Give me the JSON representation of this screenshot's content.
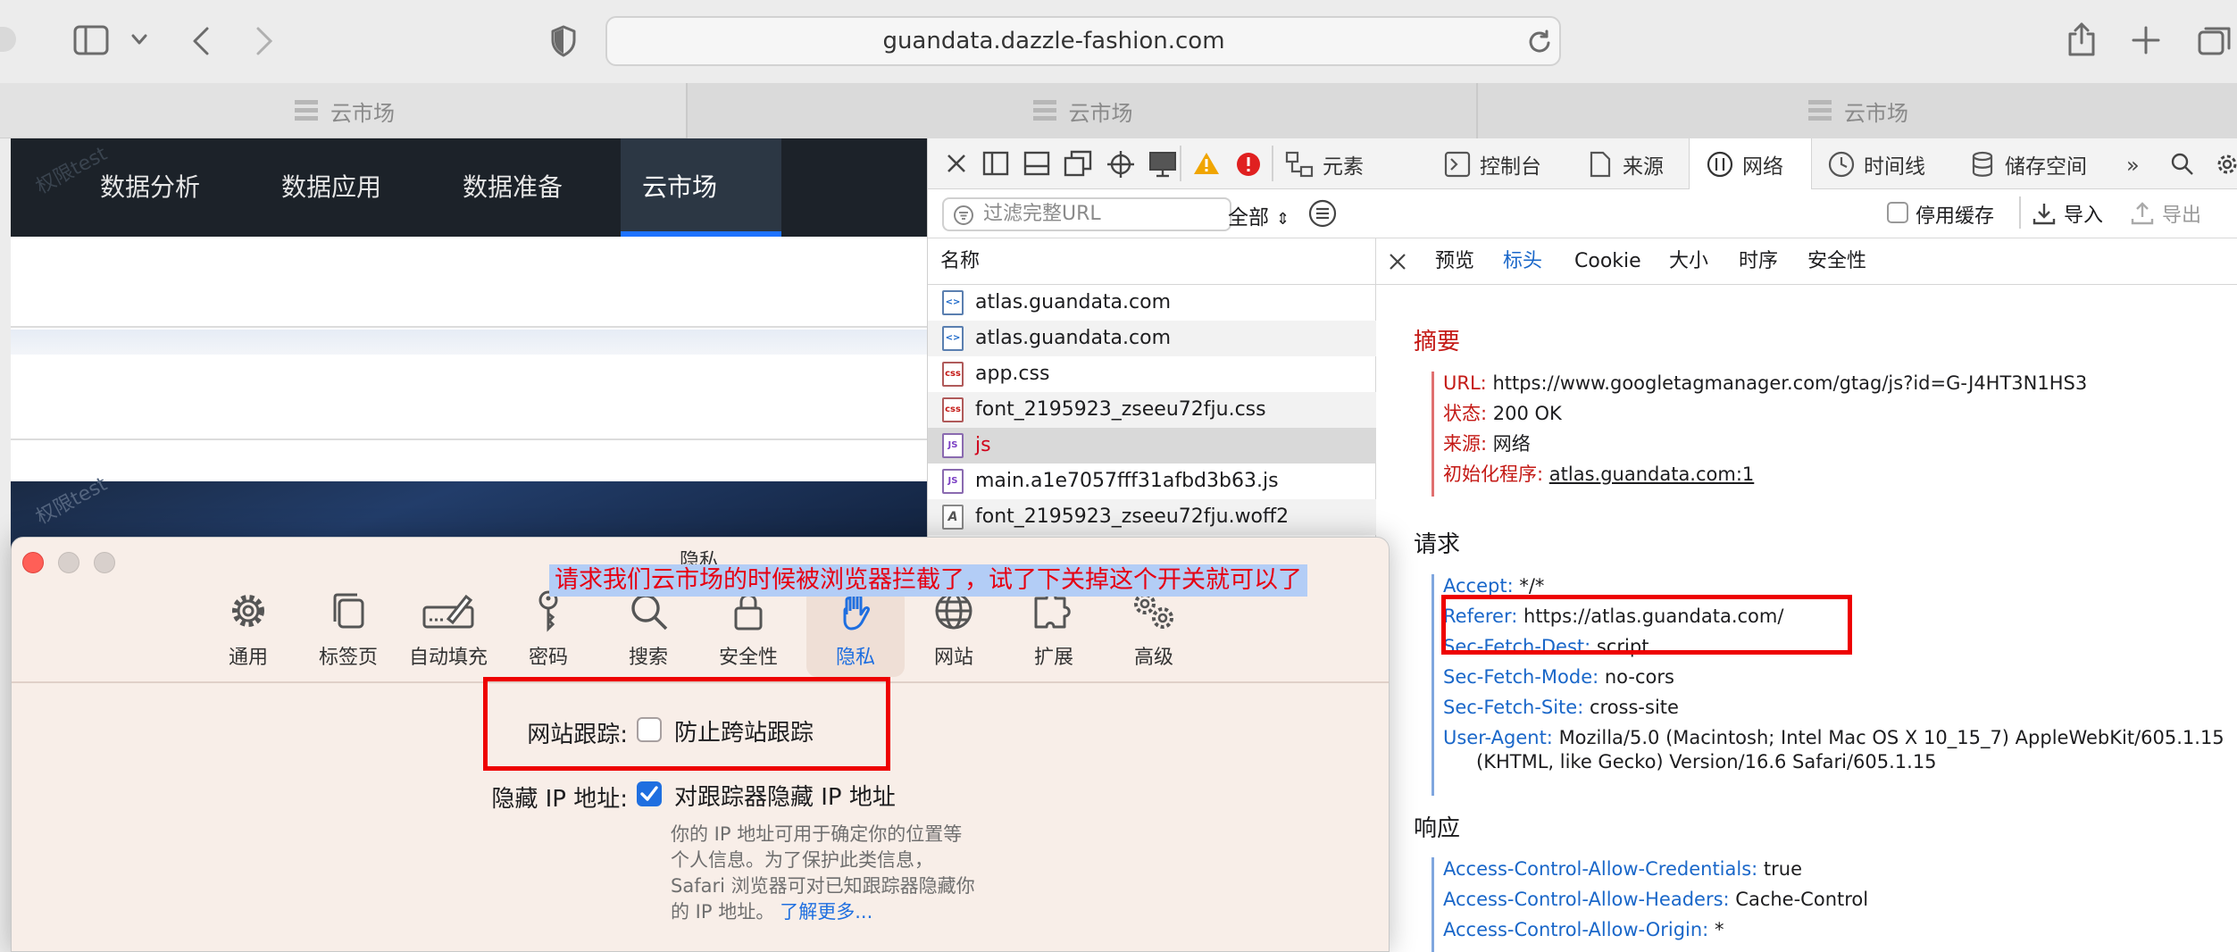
{
  "browser": {
    "url": "guandata.dazzle-fashion.com",
    "tabs": [
      {
        "label": "云市场"
      },
      {
        "label": "云市场"
      },
      {
        "label": "云市场"
      }
    ]
  },
  "webpage": {
    "nav": [
      "数据分析",
      "数据应用",
      "数据准备",
      "云市场"
    ],
    "active_nav": "云市场",
    "watermark": "权限test"
  },
  "devtools": {
    "tabs": [
      "元素",
      "控制台",
      "来源",
      "网络",
      "时间线",
      "储存空间"
    ],
    "active_tab": "网络",
    "filter_placeholder": "过滤完整URL",
    "type_filter": "全部",
    "disable_cache": "停用缓存",
    "import": "导入",
    "export": "导出",
    "list_header": "名称",
    "requests": [
      {
        "name": "atlas.guandata.com",
        "type": "html"
      },
      {
        "name": "atlas.guandata.com",
        "type": "html"
      },
      {
        "name": "app.css",
        "type": "css"
      },
      {
        "name": "font_2195923_zseeu72fju.css",
        "type": "css"
      },
      {
        "name": "js",
        "type": "js"
      },
      {
        "name": "main.a1e7057fff31afbd3b63.js",
        "type": "js"
      },
      {
        "name": "font_2195923_zseeu72fju.woff2",
        "type": "font"
      }
    ],
    "detail_tabs": [
      "预览",
      "标头",
      "Cookie",
      "大小",
      "时序",
      "安全性"
    ],
    "active_detail_tab": "标头",
    "summary": {
      "title": "摘要",
      "items": [
        {
          "k": "URL:",
          "v": "https://www.googletagmanager.com/gtag/js?id=G-J4HT3N1HS3"
        },
        {
          "k": "状态:",
          "v": "200 OK"
        },
        {
          "k": "来源:",
          "v": "网络"
        },
        {
          "k": "初始化程序:",
          "v": "atlas.guandata.com:1"
        }
      ]
    },
    "request": {
      "title": "请求",
      "items": [
        {
          "k": "Accept:",
          "v": "*/*"
        },
        {
          "k": "Referer:",
          "v": "https://atlas.guandata.com/"
        },
        {
          "k": "Sec-Fetch-Dest:",
          "v": "script"
        },
        {
          "k": "Sec-Fetch-Mode:",
          "v": "no-cors"
        },
        {
          "k": "Sec-Fetch-Site:",
          "v": "cross-site"
        },
        {
          "k": "User-Agent:",
          "v": "Mozilla/5.0 (Macintosh; Intel Mac OS X 10_15_7) AppleWebKit/605.1.15"
        },
        {
          "k": "",
          "v": "(KHTML, like Gecko) Version/16.6 Safari/605.1.15"
        }
      ]
    },
    "response": {
      "title": "响应",
      "items": [
        {
          "k": "Access-Control-Allow-Credentials:",
          "v": "true"
        },
        {
          "k": "Access-Control-Allow-Headers:",
          "v": "Cache-Control"
        },
        {
          "k": "Access-Control-Allow-Origin:",
          "v": "*"
        }
      ]
    }
  },
  "prefs": {
    "title": "隐私",
    "items": [
      "通用",
      "标签页",
      "自动填充",
      "密码",
      "搜索",
      "安全性",
      "隐私",
      "网站",
      "扩展",
      "高级"
    ],
    "active_item": "隐私",
    "tracking_label": "网站跟踪:",
    "tracking_option": "防止跨站跟踪",
    "tracking_checked": false,
    "hide_ip_label": "隐藏 IP 地址:",
    "hide_ip_option": "对跟踪器隐藏 IP 地址",
    "hide_ip_checked": true,
    "hint_lines": [
      "你的 IP 地址可用于确定你的位置等",
      "个人信息。为了保护此类信息，",
      "Safari 浏览器可对已知跟踪器隐藏你",
      "的 IP 地址。"
    ],
    "learn_more": "了解更多..."
  },
  "annotation": "请求我们云市场的时候被浏览器拦截了，试了下关掉这个开关就可以了",
  "colors": {
    "accent_blue": "#1f73ff",
    "highlight_red": "#e00000",
    "key_red": "#c41a16",
    "key_blue": "#1a67c9"
  }
}
